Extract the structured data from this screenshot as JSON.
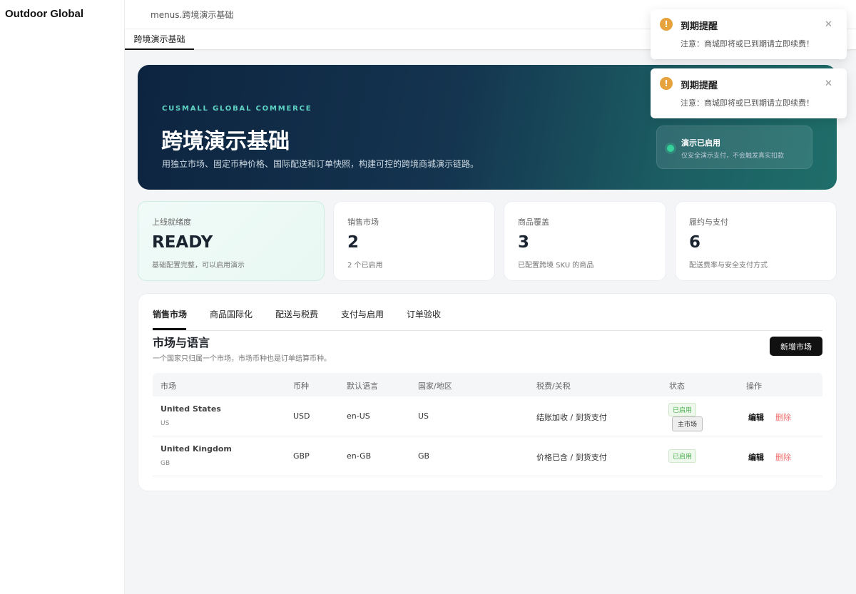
{
  "app": {
    "brand": "Outdoor Global",
    "breadcrumb": "menus.跨境演示基础",
    "open_tab": "跨境演示基础"
  },
  "hero": {
    "eyebrow": "CUSMALL GLOBAL COMMERCE",
    "title": "跨境演示基础",
    "description": "用独立市场、固定币种价格、国际配送和订单快照，构建可控的跨境商城演示链路。",
    "status_title": "演示已启用",
    "status_sub": "仅安全演示支付，不会触发真实扣款"
  },
  "stats": [
    {
      "label": "上线就绪度",
      "value": "READY",
      "note": "基础配置完整，可以启用演示"
    },
    {
      "label": "销售市场",
      "value": "2",
      "note": "2 个已启用"
    },
    {
      "label": "商品覆盖",
      "value": "3",
      "note": "已配置跨境 SKU 的商品"
    },
    {
      "label": "履约与支付",
      "value": "6",
      "note": "配送费率与安全支付方式"
    }
  ],
  "panel_tabs": [
    "销售市场",
    "商品国际化",
    "配送与税费",
    "支付与启用",
    "订单验收"
  ],
  "section": {
    "title": "市场与语言",
    "description": "一个国家只归属一个市场，市场币种也是订单结算币种。",
    "add_button": "新增市场"
  },
  "table": {
    "headers": [
      "市场",
      "币种",
      "默认语言",
      "国家/地区",
      "税费/关税",
      "状态",
      "操作"
    ],
    "rows": [
      {
        "name": "United States",
        "code": "US",
        "currency": "USD",
        "language": "en-US",
        "country": "US",
        "tax": "结账加收 / 到货支付",
        "status": "已启用",
        "primary": "主市场",
        "edit": "编辑",
        "delete": "删除"
      },
      {
        "name": "United Kingdom",
        "code": "GB",
        "currency": "GBP",
        "language": "en-GB",
        "country": "GB",
        "tax": "价格已含 / 到货支付",
        "status": "已启用",
        "primary": "",
        "edit": "编辑",
        "delete": "删除"
      }
    ]
  },
  "toasts": [
    {
      "title": "到期提醒",
      "message": "注意：商城即将或已到期请立即续费！",
      "icon": "warning-icon"
    },
    {
      "title": "到期提醒",
      "message": "注意：商城即将或已到期请立即续费！",
      "icon": "warning-icon"
    }
  ],
  "colors": {
    "accent": "#111111",
    "success": "#34d399",
    "warning": "#e6a23c",
    "danger": "#f06a6a",
    "hero_start": "#0d2440",
    "hero_end": "#1f6e6a"
  }
}
